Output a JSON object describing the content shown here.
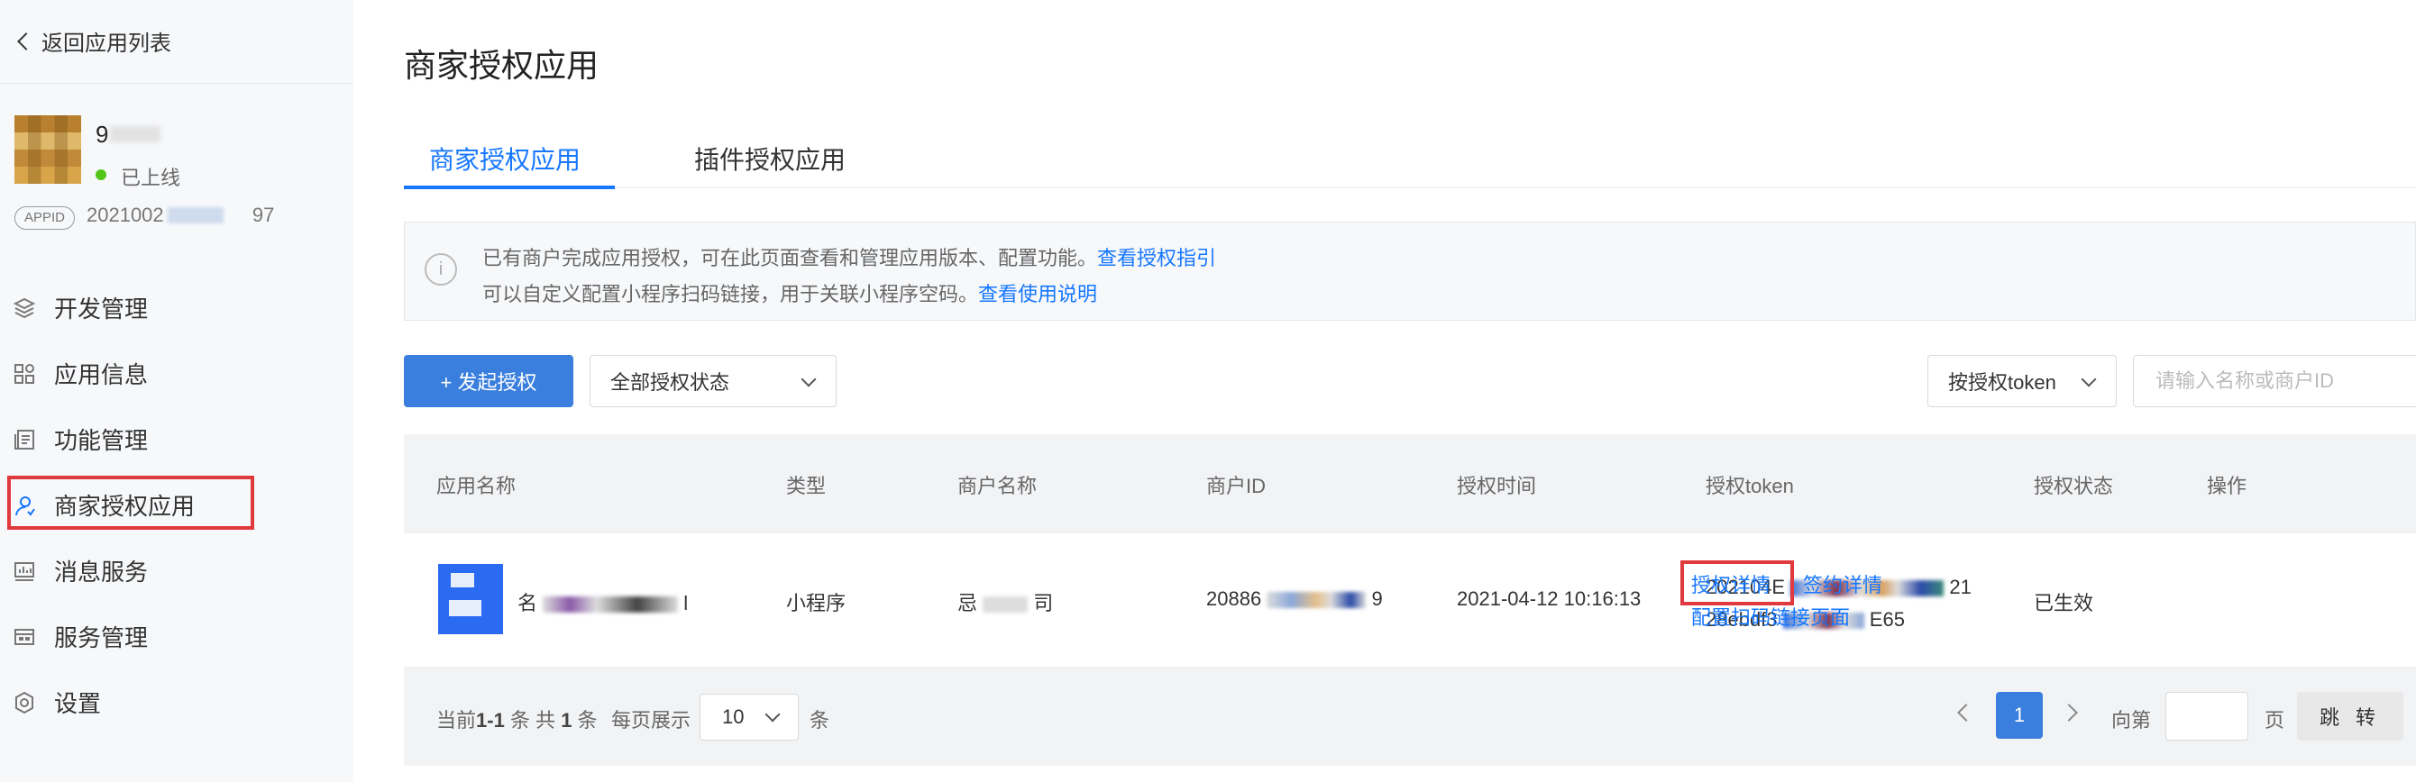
{
  "sidebar": {
    "back_label": "返回应用列表",
    "app": {
      "name": "9",
      "status": "已上线",
      "appid_badge": "APPID",
      "appid": "2021002",
      "appid_tail": "97"
    },
    "items": [
      {
        "label": "开发管理",
        "icon": "layers-icon"
      },
      {
        "label": "应用信息",
        "icon": "grid-apps-icon"
      },
      {
        "label": "功能管理",
        "icon": "document-list-icon"
      },
      {
        "label": "商家授权应用",
        "icon": "user-icon",
        "active": true
      },
      {
        "label": "消息服务",
        "icon": "chart-board-icon"
      },
      {
        "label": "服务管理",
        "icon": "panel-icon"
      },
      {
        "label": "设置",
        "icon": "gear-icon"
      }
    ]
  },
  "main": {
    "title": "商家授权应用",
    "tabs": [
      {
        "label": "商家授权应用",
        "active": true
      },
      {
        "label": "插件授权应用"
      }
    ],
    "notice": {
      "line1": "已有商户完成应用授权，可在此页面查看和管理应用版本、配置功能。",
      "link1": "查看授权指引",
      "line2": "可以自定义配置小程序扫码链接，用于关联小程序空码。",
      "link2": "查看使用说明"
    },
    "toolbar": {
      "start_auth": "+ 发起授权",
      "status_filter": "全部授权状态",
      "search_by": "按授权token",
      "search_placeholder": "请输入名称或商户ID"
    },
    "table": {
      "columns": [
        "应用名称",
        "类型",
        "商户名称",
        "商户ID",
        "授权时间",
        "授权token",
        "授权状态",
        "操作"
      ],
      "rows": [
        {
          "app_name": "名",
          "app_name_tail": "l",
          "type": "小程序",
          "merchant_name": "忌",
          "merchant_name_tail": "司",
          "merchant_id": "20886",
          "merchant_id_tail": "9",
          "auth_time": "2021-04-12 10:16:13",
          "token_line1": "202104E",
          "token_line1_tail": "21",
          "token_line2": "28ebdf3",
          "token_line2_tail": "E65",
          "status": "已生效",
          "actions": {
            "detail": "授权详情",
            "contract": "签约详情",
            "config": "配置扫码链接页面"
          }
        }
      ]
    },
    "pagination": {
      "summary_prefix": "当前",
      "range": "1-1",
      "summary_mid": "条 共",
      "total": "1",
      "summary_suffix": "条",
      "per_page_label": "每页展示",
      "per_page": "10",
      "per_page_unit": "条",
      "current_page": "1",
      "goto_label": "向第",
      "goto_unit": "页",
      "goto_button": "跳 转"
    }
  }
}
